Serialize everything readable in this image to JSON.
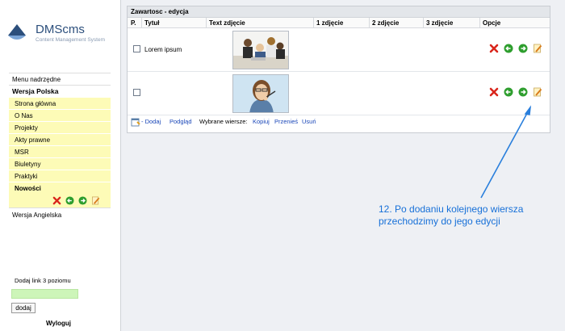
{
  "logo": {
    "name": "DMScms",
    "tagline": "Content Management System"
  },
  "sidebar": {
    "parent_menu": "Menu nadrzędne",
    "section_pl": "Wersja Polska",
    "items": [
      "Strona główna",
      "O Nas",
      "Projekty",
      "Akty prawne",
      "MSR",
      "Biuletyny",
      "Praktyki"
    ],
    "active_item": "Nowości",
    "section_en": "Wersja Angielska",
    "add_link_label": "Dodaj link 3 poziomu",
    "add_link_value": "",
    "add_button": "dodaj",
    "logout": "Wyloguj"
  },
  "panel": {
    "title": "Zawartosc - edycja",
    "columns": [
      "P.",
      "Tytuł",
      "Text zdjęcie",
      "1 zdjęcie",
      "2 zdjęcie",
      "3 zdjęcie",
      "Opcje"
    ],
    "rows": [
      {
        "checked": false,
        "title": "Lorem ipsum",
        "image": "group-of-people-at-desk"
      },
      {
        "checked": false,
        "title": "",
        "image": "woman-with-pen"
      }
    ],
    "actions": {
      "add": "- Dodaj",
      "preview": "Podgląd",
      "selected_label": "Wybrane wiersze:",
      "copy": "Kopiuj",
      "move": "Przenieś",
      "delete": "Usuń"
    }
  },
  "annotation": {
    "line1": "12. Po dodaniu kolejnego wiersza",
    "line2": "przechodzimy do jego edycji"
  },
  "colors": {
    "menu_item_bg": "#fdfbb7",
    "delete_red": "#d9261c",
    "move_green": "#2e9e2e",
    "annotation_blue": "#1770d8",
    "link_blue": "#1946b8"
  }
}
